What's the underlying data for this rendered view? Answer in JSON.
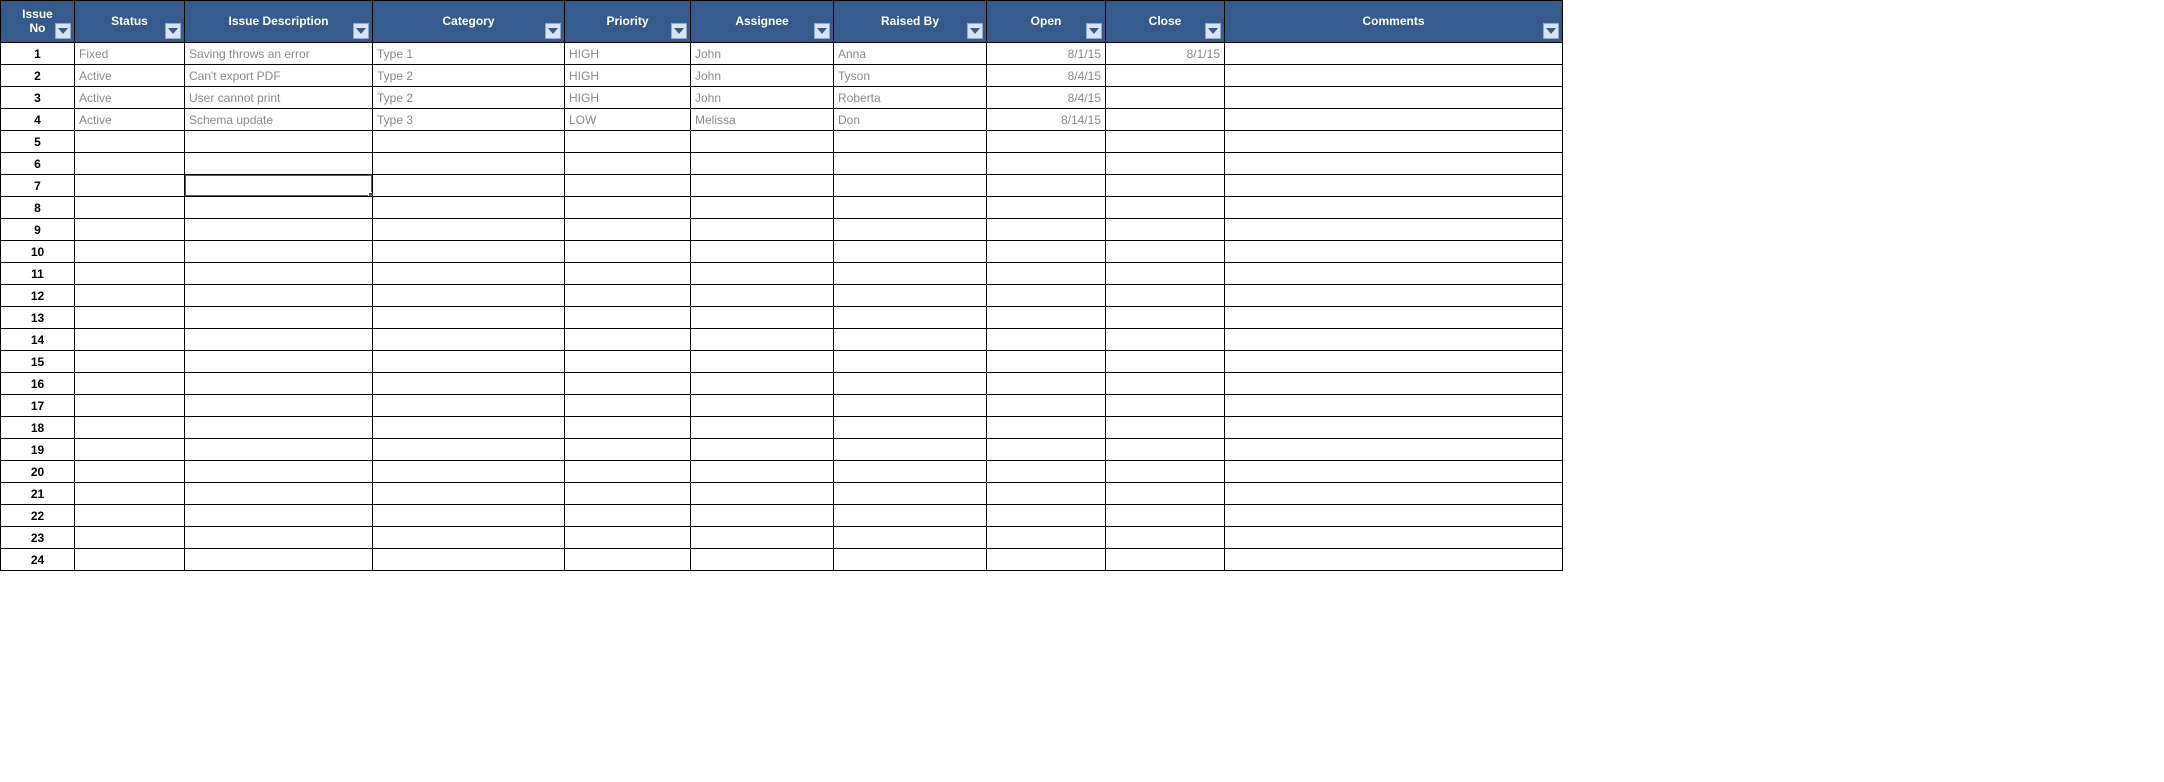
{
  "colors": {
    "header_bg": "#345b8b",
    "header_fg": "#ffffff",
    "filter_bg": "#d6e4f5",
    "filter_border": "#8fa9c9",
    "cell_text": "#888a8c",
    "selection": "#2a66c8"
  },
  "columns": [
    {
      "key": "issue_no",
      "label": "Issue No",
      "cls": "col-issue",
      "align": "center",
      "two_line": true
    },
    {
      "key": "status",
      "label": "Status",
      "cls": "col-status",
      "align": "left",
      "two_line": false
    },
    {
      "key": "desc",
      "label": "Issue Description",
      "cls": "col-desc",
      "align": "left",
      "two_line": false
    },
    {
      "key": "category",
      "label": "Category",
      "cls": "col-cat",
      "align": "left",
      "two_line": false
    },
    {
      "key": "priority",
      "label": "Priority",
      "cls": "col-prio",
      "align": "left",
      "two_line": false
    },
    {
      "key": "assignee",
      "label": "Assignee",
      "cls": "col-assign",
      "align": "left",
      "two_line": false
    },
    {
      "key": "raised_by",
      "label": "Raised By",
      "cls": "col-raised",
      "align": "left",
      "two_line": false
    },
    {
      "key": "open",
      "label": "Open",
      "cls": "col-open",
      "align": "right",
      "two_line": false
    },
    {
      "key": "close",
      "label": "Close",
      "cls": "col-close",
      "align": "right",
      "two_line": false
    },
    {
      "key": "comments",
      "label": "Comments",
      "cls": "col-comm",
      "align": "left",
      "two_line": false
    }
  ],
  "rows": [
    {
      "issue_no": "1",
      "status": "Fixed",
      "desc": "Saving throws an error",
      "category": "Type 1",
      "priority": "HIGH",
      "assignee": "John",
      "raised_by": "Anna",
      "open": "8/1/15",
      "close": "8/1/15",
      "comments": ""
    },
    {
      "issue_no": "2",
      "status": "Active",
      "desc": "Can't export PDF",
      "category": "Type 2",
      "priority": "HIGH",
      "assignee": "John",
      "raised_by": "Tyson",
      "open": "8/4/15",
      "close": "",
      "comments": ""
    },
    {
      "issue_no": "3",
      "status": "Active",
      "desc": "User cannot print",
      "category": "Type 2",
      "priority": "HIGH",
      "assignee": "John",
      "raised_by": "Roberta",
      "open": "8/4/15",
      "close": "",
      "comments": ""
    },
    {
      "issue_no": "4",
      "status": "Active",
      "desc": "Schema update",
      "category": "Type 3",
      "priority": "LOW",
      "assignee": "Melissa",
      "raised_by": "Don",
      "open": "8/14/15",
      "close": "",
      "comments": ""
    },
    {
      "issue_no": "5",
      "status": "",
      "desc": "",
      "category": "",
      "priority": "",
      "assignee": "",
      "raised_by": "",
      "open": "",
      "close": "",
      "comments": ""
    },
    {
      "issue_no": "6",
      "status": "",
      "desc": "",
      "category": "",
      "priority": "",
      "assignee": "",
      "raised_by": "",
      "open": "",
      "close": "",
      "comments": ""
    },
    {
      "issue_no": "7",
      "status": "",
      "desc": "",
      "category": "",
      "priority": "",
      "assignee": "",
      "raised_by": "",
      "open": "",
      "close": "",
      "comments": ""
    },
    {
      "issue_no": "8",
      "status": "",
      "desc": "",
      "category": "",
      "priority": "",
      "assignee": "",
      "raised_by": "",
      "open": "",
      "close": "",
      "comments": ""
    },
    {
      "issue_no": "9",
      "status": "",
      "desc": "",
      "category": "",
      "priority": "",
      "assignee": "",
      "raised_by": "",
      "open": "",
      "close": "",
      "comments": ""
    },
    {
      "issue_no": "10",
      "status": "",
      "desc": "",
      "category": "",
      "priority": "",
      "assignee": "",
      "raised_by": "",
      "open": "",
      "close": "",
      "comments": ""
    },
    {
      "issue_no": "11",
      "status": "",
      "desc": "",
      "category": "",
      "priority": "",
      "assignee": "",
      "raised_by": "",
      "open": "",
      "close": "",
      "comments": ""
    },
    {
      "issue_no": "12",
      "status": "",
      "desc": "",
      "category": "",
      "priority": "",
      "assignee": "",
      "raised_by": "",
      "open": "",
      "close": "",
      "comments": ""
    },
    {
      "issue_no": "13",
      "status": "",
      "desc": "",
      "category": "",
      "priority": "",
      "assignee": "",
      "raised_by": "",
      "open": "",
      "close": "",
      "comments": ""
    },
    {
      "issue_no": "14",
      "status": "",
      "desc": "",
      "category": "",
      "priority": "",
      "assignee": "",
      "raised_by": "",
      "open": "",
      "close": "",
      "comments": ""
    },
    {
      "issue_no": "15",
      "status": "",
      "desc": "",
      "category": "",
      "priority": "",
      "assignee": "",
      "raised_by": "",
      "open": "",
      "close": "",
      "comments": ""
    },
    {
      "issue_no": "16",
      "status": "",
      "desc": "",
      "category": "",
      "priority": "",
      "assignee": "",
      "raised_by": "",
      "open": "",
      "close": "",
      "comments": ""
    },
    {
      "issue_no": "17",
      "status": "",
      "desc": "",
      "category": "",
      "priority": "",
      "assignee": "",
      "raised_by": "",
      "open": "",
      "close": "",
      "comments": ""
    },
    {
      "issue_no": "18",
      "status": "",
      "desc": "",
      "category": "",
      "priority": "",
      "assignee": "",
      "raised_by": "",
      "open": "",
      "close": "",
      "comments": ""
    },
    {
      "issue_no": "19",
      "status": "",
      "desc": "",
      "category": "",
      "priority": "",
      "assignee": "",
      "raised_by": "",
      "open": "",
      "close": "",
      "comments": ""
    },
    {
      "issue_no": "20",
      "status": "",
      "desc": "",
      "category": "",
      "priority": "",
      "assignee": "",
      "raised_by": "",
      "open": "",
      "close": "",
      "comments": ""
    },
    {
      "issue_no": "21",
      "status": "",
      "desc": "",
      "category": "",
      "priority": "",
      "assignee": "",
      "raised_by": "",
      "open": "",
      "close": "",
      "comments": ""
    },
    {
      "issue_no": "22",
      "status": "",
      "desc": "",
      "category": "",
      "priority": "",
      "assignee": "",
      "raised_by": "",
      "open": "",
      "close": "",
      "comments": ""
    },
    {
      "issue_no": "23",
      "status": "",
      "desc": "",
      "category": "",
      "priority": "",
      "assignee": "",
      "raised_by": "",
      "open": "",
      "close": "",
      "comments": ""
    },
    {
      "issue_no": "24",
      "status": "",
      "desc": "",
      "category": "",
      "priority": "",
      "assignee": "",
      "raised_by": "",
      "open": "",
      "close": "",
      "comments": ""
    }
  ],
  "selection": {
    "row": 6,
    "col": "desc"
  }
}
